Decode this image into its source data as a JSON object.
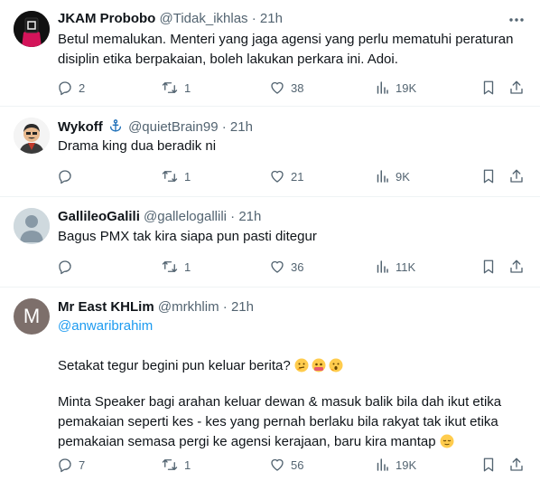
{
  "tweets": [
    {
      "name": "JKAM Probobo",
      "handle": "@Tidak_ikhlas",
      "time": "21h",
      "text": "Betul memalukan. Menteri yang jaga agensi yang perlu mematuhi peraturan disiplin etika berpakaian, boleh lakukan perkara ini. Adoi.",
      "replies": "2",
      "reposts": "1",
      "likes": "38",
      "views": "19K"
    },
    {
      "name": "Wykoff",
      "handle": "@quietBrain99",
      "time": "21h",
      "text": "Drama king dua beradik ni",
      "replies": "",
      "reposts": "1",
      "likes": "21",
      "views": "9K"
    },
    {
      "name": "GallileoGalili",
      "handle": "@gallelogallili",
      "time": "21h",
      "text": "Bagus PMX tak kira siapa pun pasti ditegur",
      "replies": "",
      "reposts": "1",
      "likes": "36",
      "views": "11K"
    },
    {
      "name": "Mr East KHLim",
      "handle": "@mrkhlim",
      "time": "21h",
      "avatar_letter": "M",
      "mention": "@anwaribrahim",
      "line2": "Setakat tegur begini pun keluar berita?",
      "line3": "Minta Speaker bagi arahan keluar dewan & masuk balik bila dah ikut etika pemakaian seperti kes - kes yang  pernah berlaku bila rakyat tak ikut etika pemakaian semasa pergi ke agensi kerajaan, baru kira mantap",
      "replies": "7",
      "reposts": "1",
      "likes": "56",
      "views": "19K"
    }
  ],
  "separator": "·",
  "colors": {
    "text": "#0f1419",
    "secondary": "#536471",
    "link": "#1d9bf0",
    "border": "#eff3f4"
  }
}
